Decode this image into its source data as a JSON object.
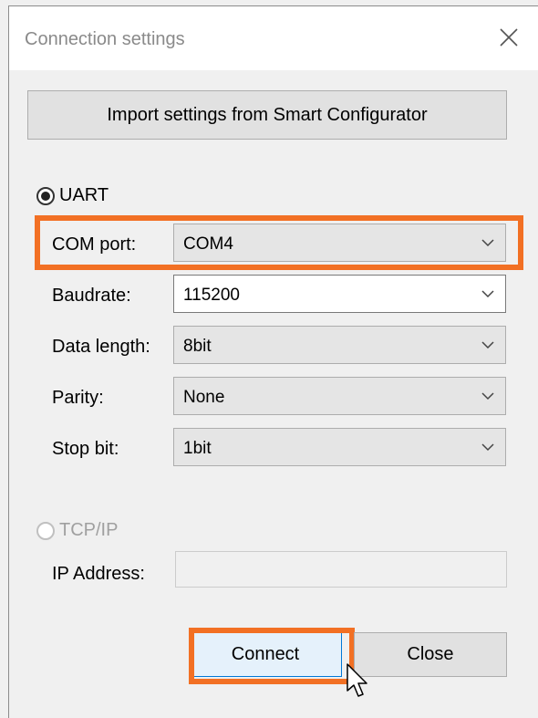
{
  "window": {
    "title": "Connection settings"
  },
  "import_button": {
    "label": "Import settings from Smart Configurator"
  },
  "uart": {
    "label": "UART",
    "selected": true,
    "fields": [
      {
        "label": "COM port:",
        "value": "COM4"
      },
      {
        "label": "Baudrate:",
        "value": "115200"
      },
      {
        "label": "Data length:",
        "value": "8bit"
      },
      {
        "label": "Parity:",
        "value": "None"
      },
      {
        "label": "Stop bit:",
        "value": "1bit"
      }
    ]
  },
  "tcpip": {
    "label": "TCP/IP",
    "selected": false,
    "enabled": false,
    "ip_label": "IP Address:",
    "ip_value": ""
  },
  "buttons": {
    "connect": "Connect",
    "close": "Close"
  },
  "colors": {
    "highlight": "#f27024",
    "connect_border": "#0078d7"
  }
}
